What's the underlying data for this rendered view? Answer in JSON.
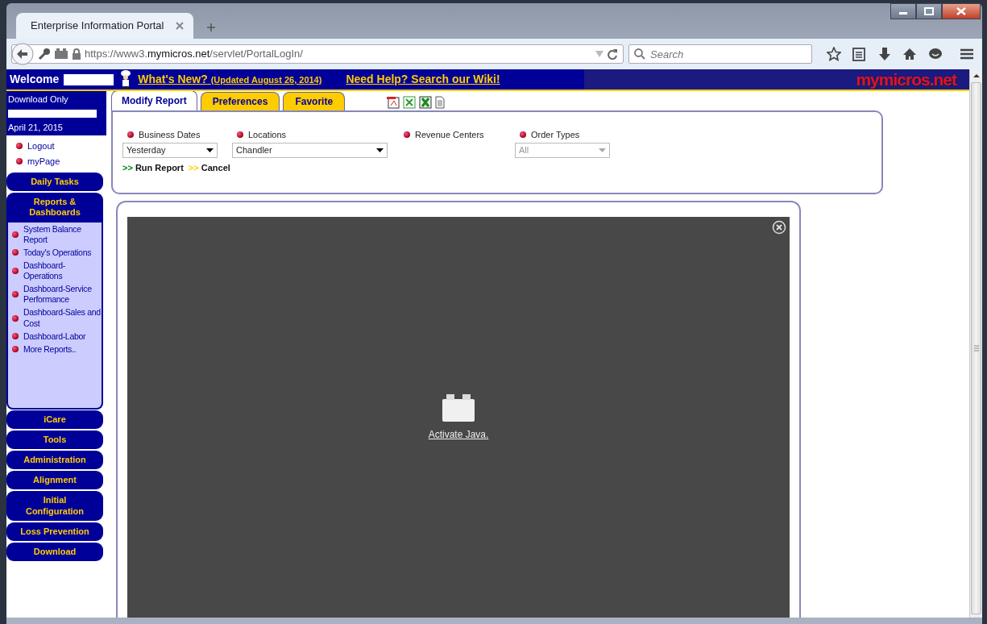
{
  "browser": {
    "tab_title": "Enterprise Information Portal",
    "url_prefix": "https://www3.",
    "url_host": "mymicros.net",
    "url_path": "/servlet/PortalLogIn/",
    "search_placeholder": "Search"
  },
  "banner": {
    "welcome": "Welcome",
    "whats_new": "What's New?",
    "updated": "(Updated August 26, 2014)",
    "help": "Need Help? Search our Wiki!",
    "logo": "mymicros.net"
  },
  "sidebar": {
    "account": "Download Only",
    "date": "April 21, 2015",
    "links": [
      "Logout",
      "myPage"
    ],
    "sections": [
      {
        "label": "Daily Tasks",
        "expanded": false
      },
      {
        "label": "Reports & Dashboards",
        "expanded": true,
        "items": [
          "System Balance Report",
          "Today's Operations",
          "Dashboard-Operations",
          "Dashboard-Service Performance",
          "Dashboard-Sales and Cost",
          "Dashboard-Labor",
          "More Reports.."
        ]
      },
      {
        "label": "iCare",
        "expanded": false
      },
      {
        "label": "Tools",
        "expanded": false
      },
      {
        "label": "Administration",
        "expanded": false
      },
      {
        "label": "Alignment",
        "expanded": false
      },
      {
        "label": "Initial Configuration",
        "expanded": false
      },
      {
        "label": "Loss Prevention",
        "expanded": false
      },
      {
        "label": "Download",
        "expanded": false
      }
    ]
  },
  "report_tabs": [
    {
      "label": "Modify Report",
      "selected": true
    },
    {
      "label": "Preferences",
      "selected": false
    },
    {
      "label": "Favorite",
      "selected": false
    }
  ],
  "filters": [
    {
      "label": "Business Dates",
      "kind": "select",
      "value": "Yesterday",
      "disabled": false
    },
    {
      "label": "Locations",
      "kind": "select",
      "value": "Chandler",
      "disabled": false
    },
    {
      "label": "Revenue Centers",
      "kind": "label"
    },
    {
      "label": "Order Types",
      "kind": "select",
      "value": "All",
      "disabled": true
    }
  ],
  "actions": [
    {
      "prefix": ">>",
      "label": "Run Report",
      "color": "#008000"
    },
    {
      "prefix": ">>",
      "label": "Cancel",
      "color": "#ffcc00"
    }
  ],
  "applet": {
    "link": "Activate Java."
  }
}
